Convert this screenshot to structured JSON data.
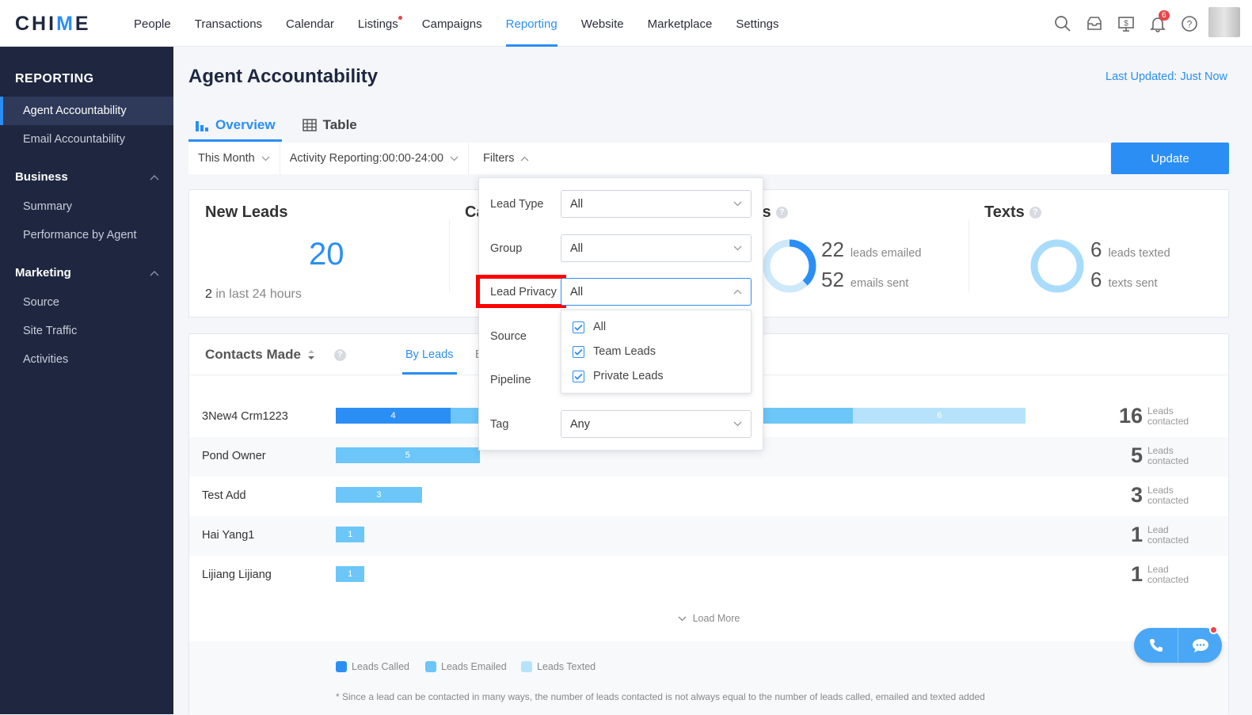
{
  "app": {
    "logo_pre": "CHI",
    "logo_accent": "M",
    "logo_post": "E"
  },
  "nav": [
    "People",
    "Transactions",
    "Calendar",
    "Listings",
    "Campaigns",
    "Reporting",
    "Website",
    "Marketplace",
    "Settings"
  ],
  "notifications_count": "6",
  "sidebar": {
    "title": "REPORTING",
    "items_top": [
      "Agent Accountability",
      "Email Accountability"
    ],
    "business": {
      "label": "Business",
      "items": [
        "Summary",
        "Performance by Agent"
      ]
    },
    "marketing": {
      "label": "Marketing",
      "items": [
        "Source",
        "Site Traffic",
        "Activities"
      ]
    }
  },
  "page": {
    "title": "Agent Accountability",
    "last_updated": "Last Updated: Just Now"
  },
  "tabs": {
    "overview": "Overview",
    "table": "Table"
  },
  "filters": {
    "period": "This Month",
    "activity": "Activity Reporting:00:00-24:00",
    "filters": "Filters",
    "update": "Update"
  },
  "stats": {
    "new_leads": {
      "title": "New Leads",
      "value": "20",
      "sub_num": "2",
      "sub_text": "in last 24 hours"
    },
    "calls_title_partial": "Ca",
    "emails": {
      "title_partial": "ls",
      "leads_n": "22",
      "leads_l": "leads emailed",
      "sent_n": "52",
      "sent_l": "emails sent"
    },
    "texts": {
      "title": "Texts",
      "leads_n": "6",
      "leads_l": "leads texted",
      "sent_n": "6",
      "sent_l": "texts sent"
    }
  },
  "contacts": {
    "title": "Contacts Made",
    "tab_by_leads": "By Leads",
    "tab_partial": "B",
    "rows": [
      {
        "name": "3New4 Crm1223",
        "called": 4,
        "emailed": 14,
        "texted": 6,
        "total": "16",
        "label1": "Leads",
        "label2": "contacted"
      },
      {
        "name": "Pond Owner",
        "called": 0,
        "emailed": 5,
        "texted": 0,
        "total": "5",
        "label1": "Leads",
        "label2": "contacted"
      },
      {
        "name": "Test Add",
        "called": 0,
        "emailed": 3,
        "texted": 0,
        "total": "3",
        "label1": "Leads",
        "label2": "contacted"
      },
      {
        "name": "Hai Yang1",
        "called": 0,
        "emailed": 1,
        "texted": 0,
        "total": "1",
        "label1": "Lead",
        "label2": "contacted"
      },
      {
        "name": "Lijiang Lijiang",
        "called": 0,
        "emailed": 1,
        "texted": 0,
        "total": "1",
        "label1": "Lead",
        "label2": "contacted"
      }
    ],
    "load_more": "Load More",
    "legend": [
      "Leads Called",
      "Leads Emailed",
      "Leads Texted"
    ],
    "note": "* Since a lead can be contacted in many ways, the number of leads contacted is not always equal to the number of leads called, emailed and texted added"
  },
  "popover": {
    "lead_type": {
      "label": "Lead Type",
      "value": "All"
    },
    "group": {
      "label": "Group",
      "value": "All"
    },
    "lead_privacy": {
      "label": "Lead Privacy",
      "value": "All"
    },
    "source": {
      "label": "Source"
    },
    "pipeline": {
      "label": "Pipeline"
    },
    "tag": {
      "label": "Tag",
      "value": "Any"
    },
    "privacy_options": [
      "All",
      "Team Leads",
      "Private Leads"
    ]
  },
  "colors": {
    "accent": "#2b8ef5",
    "called": "#2b8ef5",
    "emailed": "#6cc6f7",
    "texted": "#b6e3fb",
    "sidebar": "#1f2740"
  }
}
